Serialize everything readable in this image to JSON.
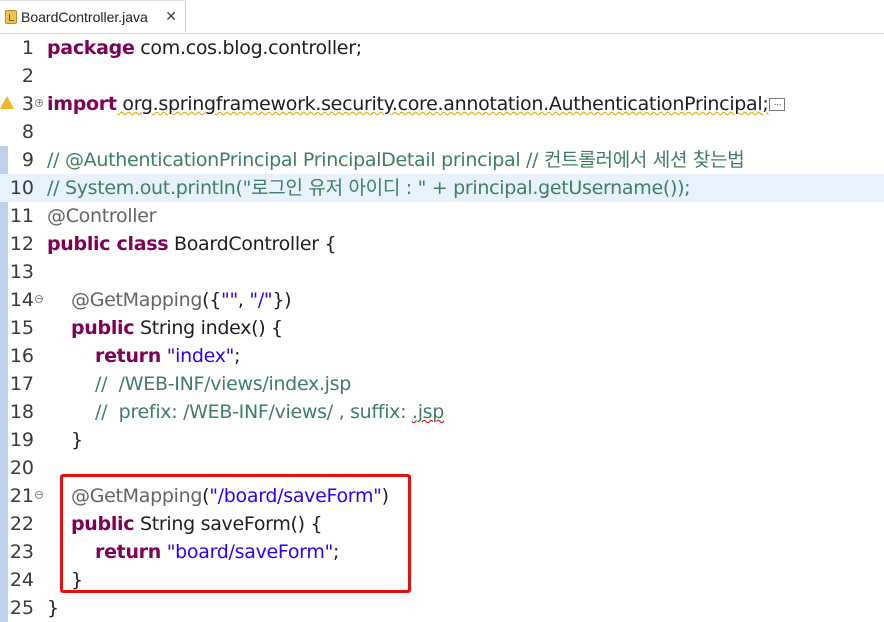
{
  "tab": {
    "title": "BoardController.java",
    "close": "✕"
  },
  "editor": {
    "line_numbers": [
      "1",
      "2",
      "3",
      "8",
      "9",
      "10",
      "11",
      "12",
      "13",
      "14",
      "15",
      "16",
      "17",
      "18",
      "19",
      "20",
      "21",
      "22",
      "23",
      "24",
      "25"
    ],
    "lines": {
      "l1_kw": "package",
      "l1_rest": " com.cos.blog.controller;",
      "l3_kw": "import",
      "l3_rest": " org.springframework.security.core.annotation.AuthenticationPrincipal;",
      "l3_more": "...",
      "l9": "// @AuthenticationPrincipal PrincipalDetail principal // 컨트롤러에서 세션 찾는법",
      "l10": "// System.out.println(\"로그인 유저 아이디 : \" + principal.getUsername());",
      "l11": "@Controller",
      "l12_kw": "public class",
      "l12_rest": " BoardController {",
      "l14_ann": "@GetMapping",
      "l14_open": "({",
      "l14_s1": "\"\"",
      "l14_comma": ", ",
      "l14_s2": "\"/\"",
      "l14_close": "})",
      "l15_kw": "public",
      "l15_rest": " String index() {",
      "l16_kw": "return",
      "l16_str": "\"index\"",
      "l16_end": ";",
      "l17": "//  /WEB-INF/views/index.jsp",
      "l18_a": "//  prefix: /WEB-INF/views/ , suffix: ",
      "l18_b": ".jsp",
      "l19": "}",
      "l21_ann": "@GetMapping",
      "l21_open": "(",
      "l21_str": "\"/board/saveForm\"",
      "l21_close": ")",
      "l22_kw": "public",
      "l22_rest": " String saveForm() {",
      "l23_kw": "return",
      "l23_str": "\"board/saveForm\"",
      "l23_end": ";",
      "l24": "}",
      "l25": "}"
    }
  },
  "colors": {
    "keyword": "#7f0055",
    "string": "#2a00ff",
    "comment": "#3f7f5f",
    "annotation": "#646464",
    "highlight_line": "#e8f2fe",
    "change_bar": "#bdd2ea",
    "red_box": "#e01010"
  },
  "icons": {
    "tab": "java-file-icon",
    "warning": "warning-icon",
    "fold": "fold-toggle-icon"
  }
}
